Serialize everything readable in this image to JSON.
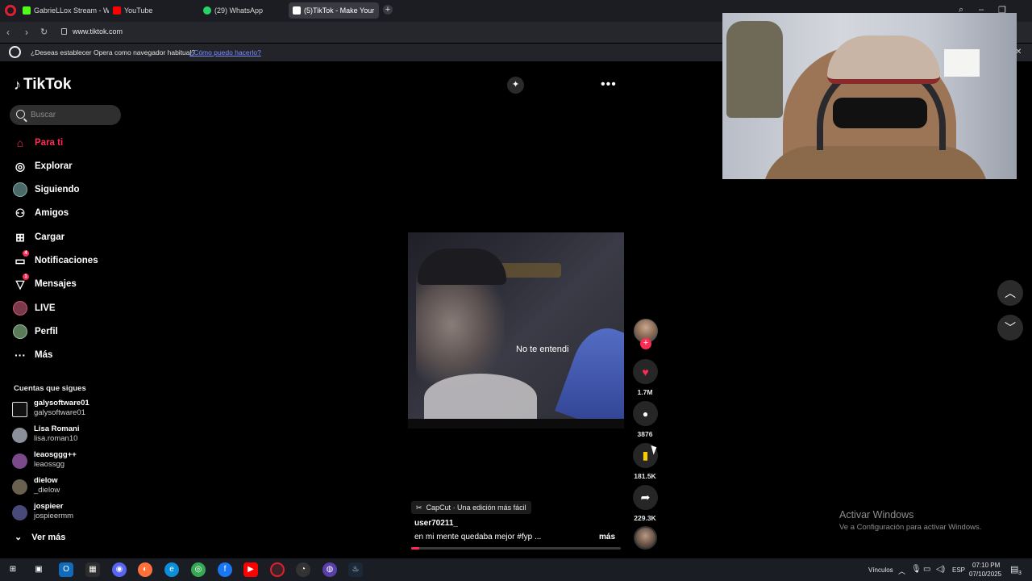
{
  "browser": {
    "tabs": [
      {
        "label": "GabrieLLox Stream - Watc",
        "icon": "kick-icon",
        "color": "#53fc18"
      },
      {
        "label": "YouTube",
        "icon": "youtube-icon",
        "color": "#ff0000"
      },
      {
        "label": "(29) WhatsApp",
        "icon": "whatsapp-icon",
        "color": "#25d366"
      },
      {
        "label": "(5)TikTok - Make Your",
        "icon": "tiktok-icon",
        "color": "#ffffff"
      }
    ],
    "url": "www.tiktok.com",
    "infobar": {
      "message": "¿Deseas establecer Opera como navegador habitual?",
      "link": "¿Cómo puedo hacerlo?"
    }
  },
  "tiktok": {
    "logo": "TikTok",
    "search_placeholder": "Buscar",
    "nav": [
      {
        "label": "Para ti",
        "icon": "home-icon",
        "active": true
      },
      {
        "label": "Explorar",
        "icon": "compass-icon"
      },
      {
        "label": "Siguiendo",
        "icon": "following-avatar-icon"
      },
      {
        "label": "Amigos",
        "icon": "friends-icon"
      },
      {
        "label": "Cargar",
        "icon": "upload-icon"
      },
      {
        "label": "Notificaciones",
        "icon": "inbox-icon",
        "badge": "4"
      },
      {
        "label": "Mensajes",
        "icon": "send-icon",
        "badge": "1"
      },
      {
        "label": "LIVE",
        "icon": "live-icon"
      },
      {
        "label": "Perfil",
        "icon": "profile-avatar-icon"
      },
      {
        "label": "Más",
        "icon": "more-icon"
      }
    ],
    "following_title": "Cuentas que sigues",
    "following": [
      {
        "name": "galysoftware01",
        "handle": "galysoftware01"
      },
      {
        "name": "Lisa Romani",
        "handle": "lisa.roman10"
      },
      {
        "name": "leaosggg++",
        "handle": "leaossgg"
      },
      {
        "name": "dielow",
        "handle": "_dielow"
      },
      {
        "name": "jospieer",
        "handle": "jospieermm"
      }
    ],
    "see_more": "Ver más",
    "video": {
      "subtitle": "No te entendi",
      "capcut_label": "CapCut · Una edición más fácil",
      "username": "user70211_",
      "description": "en mi mente quedaba mejor #fyp  ...",
      "more": "más",
      "progress": 0.04
    },
    "actions": {
      "likes": "1.7M",
      "comments": "3876",
      "saves": "181.5K",
      "shares": "229.3K",
      "like_color": "#fe2c55",
      "save_color": "#facd00"
    }
  },
  "windows": {
    "activate_title": "Activar Windows",
    "activate_sub": "Ve a Configuración para activar Windows.",
    "links_label": "Vínculos",
    "lang": "ESP",
    "time": "07:10 PM",
    "date": "07/10/2025",
    "notif_count": "3"
  }
}
